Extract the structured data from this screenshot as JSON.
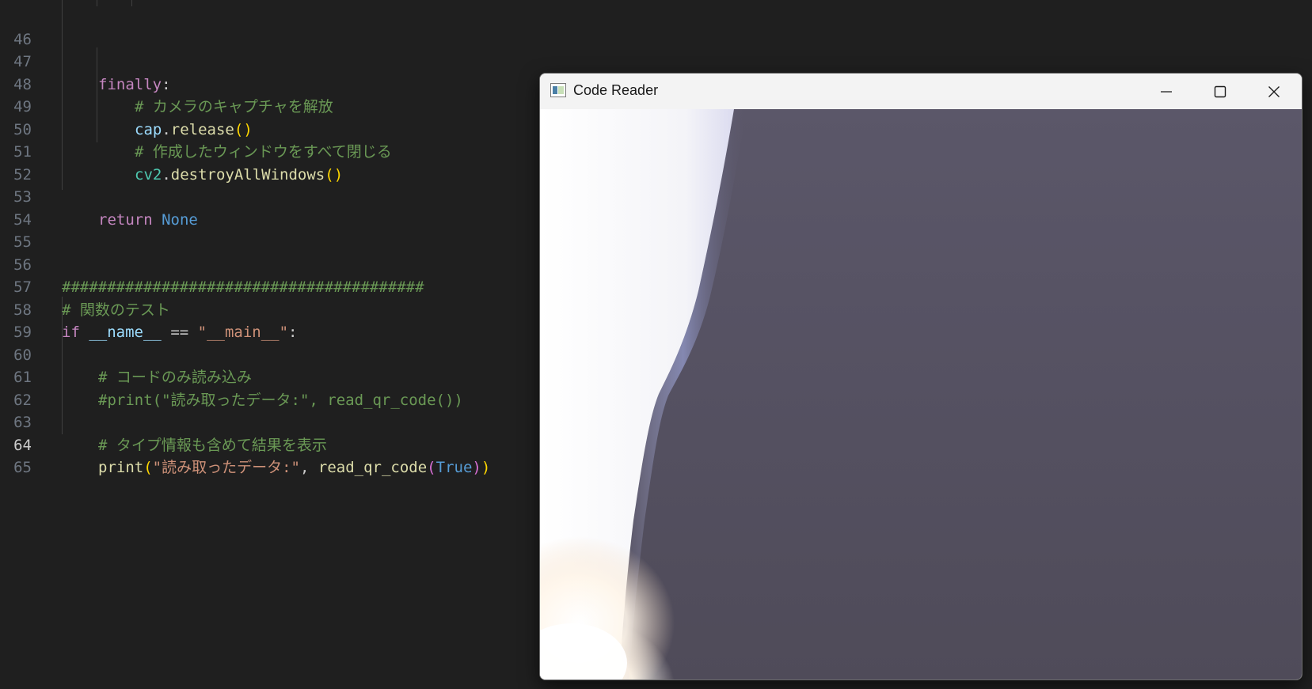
{
  "editor": {
    "active_line": 64,
    "lines": [
      {
        "num": 46,
        "text": ""
      },
      {
        "num": 47,
        "text": "    finally:"
      },
      {
        "num": 48,
        "text": "        # カメラのキャプチャを解放"
      },
      {
        "num": 49,
        "text": "        cap.release()"
      },
      {
        "num": 50,
        "text": "        # 作成したウィンドウをすべて閉じる"
      },
      {
        "num": 51,
        "text": "        cv2.destroyAllWindows()"
      },
      {
        "num": 52,
        "text": ""
      },
      {
        "num": 53,
        "text": "    return None"
      },
      {
        "num": 54,
        "text": ""
      },
      {
        "num": 55,
        "text": ""
      },
      {
        "num": 56,
        "text": "########################################"
      },
      {
        "num": 57,
        "text": "# 関数のテスト"
      },
      {
        "num": 58,
        "text": "if __name__ == \"__main__\":"
      },
      {
        "num": 59,
        "text": ""
      },
      {
        "num": 60,
        "text": "    # コードのみ読み込み"
      },
      {
        "num": 61,
        "text": "    #print(\"読み取ったデータ:\", read_qr_code())"
      },
      {
        "num": 62,
        "text": ""
      },
      {
        "num": 63,
        "text": "    # タイプ情報も含めて結果を表示"
      },
      {
        "num": 64,
        "text": "    print(\"読み取ったデータ:\", read_qr_code(True))"
      },
      {
        "num": 65,
        "text": ""
      }
    ],
    "tokens": {
      "l47": {
        "finally": "finally",
        "colon": ":"
      },
      "l48": "# カメラのキャプチャを解放",
      "l49": {
        "obj": "cap",
        "dot": ".",
        "fn": "release",
        "open": "(",
        "close": ")"
      },
      "l50": "# 作成したウィンドウをすべて閉じる",
      "l51": {
        "obj": "cv2",
        "dot": ".",
        "fn": "destroyAllWindows",
        "open": "(",
        "close": ")"
      },
      "l53": {
        "ret": "return",
        "val": "None"
      },
      "l56": "########################################",
      "l57": "# 関数のテスト",
      "l58": {
        "if": "if",
        "name": "__name__",
        "eq": "==",
        "str": "\"__main__\"",
        "colon": ":"
      },
      "l60": "# コードのみ読み込み",
      "l61": "#print(\"読み取ったデータ:\", read_qr_code())",
      "l63": "# タイプ情報も含めて結果を表示",
      "l64": {
        "fn": "print",
        "open": "(",
        "str": "\"読み取ったデータ:\"",
        "comma": ",",
        "fn2": "read_qr_code",
        "open2": "(",
        "arg": "True",
        "close2": ")",
        "close": ")"
      }
    }
  },
  "window": {
    "title": "Code Reader",
    "icon": "app-window-icon",
    "controls": [
      "minimize-icon",
      "maximize-icon",
      "close-icon"
    ],
    "content": "camera-feed"
  }
}
